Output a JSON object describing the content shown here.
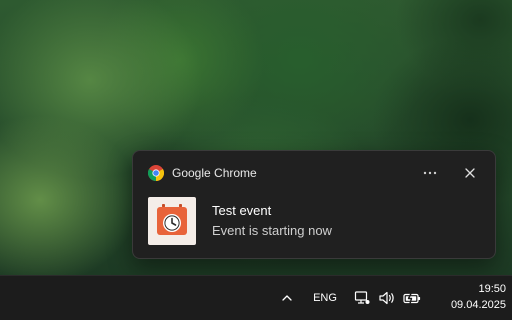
{
  "notification": {
    "app_name": "Google Chrome",
    "app_icon": "chrome-icon",
    "more_icon": "more-icon",
    "close_icon": "close-icon",
    "title": "Test event",
    "message": "Event is starting now",
    "image_icon": "calendar-clock-icon",
    "accent_color": "#e8633a"
  },
  "taskbar": {
    "overflow_icon": "chevron-up-icon",
    "language": "ENG",
    "tray_icons": [
      "network-icon",
      "volume-icon",
      "battery-icon"
    ],
    "time": "19:50",
    "date": "09.04.2025"
  }
}
